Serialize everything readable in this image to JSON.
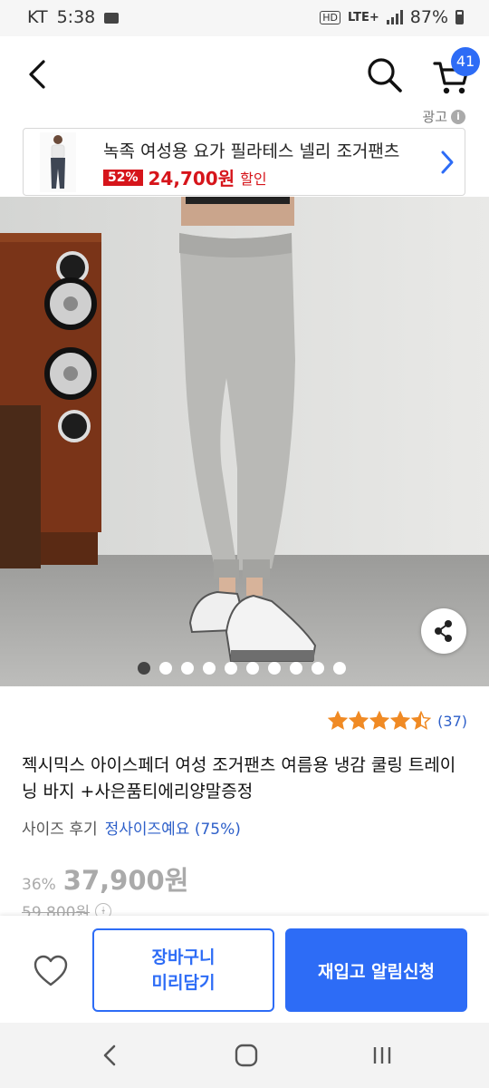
{
  "status_bar": {
    "carrier": "KT",
    "time": "5:38",
    "hd": "HD",
    "network": "LTE+",
    "battery": "87%"
  },
  "header": {
    "cart_count": "41",
    "ad_label": "광고",
    "ad_info": "i"
  },
  "ad_banner": {
    "title": "녹족 여성용 요가 필라테스 넬리 조거팬츠",
    "discount": "52%",
    "price": "24,700원",
    "sale_label": "할인"
  },
  "gallery": {
    "image_count": 10,
    "active_index": 0
  },
  "product": {
    "rating": 4.5,
    "review_count": "(37)",
    "title": "젝시믹스 아이스페더 여성 조거팬츠 여름용 냉감 쿨링 트레이닝 바지 +사은품티에리양말증정",
    "size_review_label": "사이즈 후기",
    "size_review_value": "정사이즈예요 (75%)",
    "discount": "36%",
    "price": "37,900원",
    "original_price": "59,800원",
    "price_info": "i"
  },
  "actions": {
    "cart_line1": "장바구니",
    "cart_line2": "미리담기",
    "restock_alert": "재입고 알림신청"
  },
  "colors": {
    "accent": "#2d6cf6",
    "sale_red": "#d6151b",
    "star": "#f08a24"
  }
}
